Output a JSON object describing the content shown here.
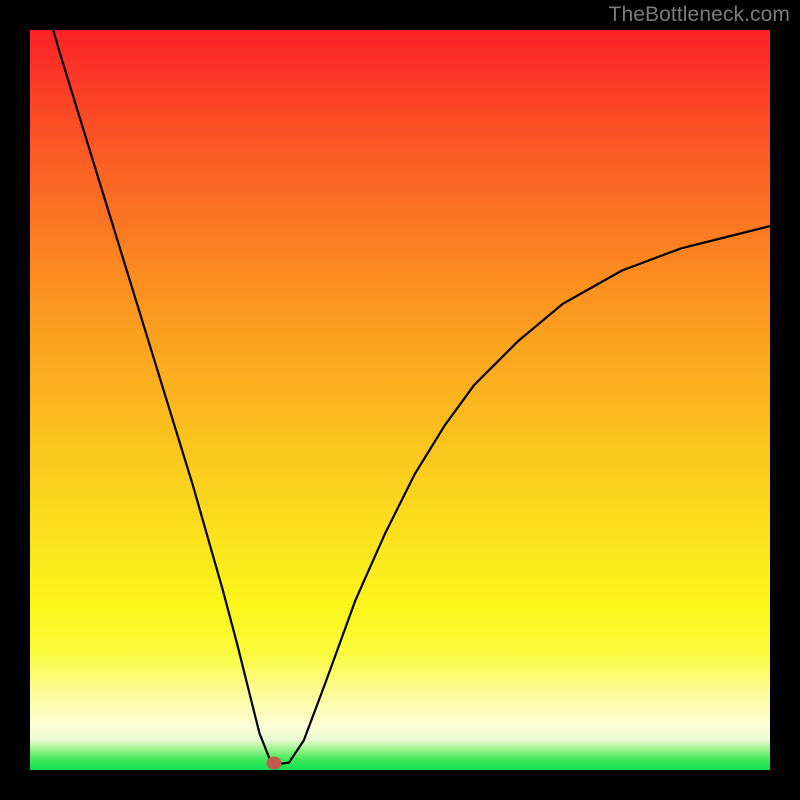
{
  "watermark": "TheBottleneck.com",
  "marker": {
    "color": "#c25a4e",
    "x_pct": 33.0,
    "y_pct": 99.0
  },
  "chart_data": {
    "type": "line",
    "title": "",
    "xlabel": "",
    "ylabel": "",
    "xlim": [
      0,
      100
    ],
    "ylim": [
      0,
      100
    ],
    "grid": false,
    "legend": false,
    "background_gradient": {
      "direction": "top-to-bottom",
      "stops": [
        {
          "pos": 0.0,
          "color": "#fb2127"
        },
        {
          "pos": 0.34,
          "color": "#fb8e20"
        },
        {
          "pos": 0.78,
          "color": "#fbf61b"
        },
        {
          "pos": 0.94,
          "color": "#fdfdd6"
        },
        {
          "pos": 1.0,
          "color": "#0ee153"
        }
      ]
    },
    "series": [
      {
        "name": "bottleneck-curve",
        "color": "#000000",
        "stroke_width": 2,
        "x": [
          0.0,
          2,
          4,
          6,
          8,
          10,
          12,
          14,
          16,
          18,
          20,
          22,
          24,
          26,
          28,
          29.5,
          31,
          32.5,
          33.5,
          35,
          37,
          40,
          44,
          48,
          52,
          56,
          60,
          66,
          72,
          80,
          88,
          96,
          100
        ],
        "y": [
          111,
          104,
          97,
          90.5,
          84,
          77.5,
          71,
          64.5,
          58,
          51.5,
          45,
          38.5,
          31.5,
          24.5,
          17,
          11,
          5,
          1.2,
          0.8,
          1.0,
          4,
          12,
          23,
          32,
          40,
          46.5,
          52,
          58,
          63,
          67.5,
          70.5,
          72.5,
          73.5
        ]
      }
    ],
    "marker_point": {
      "x": 33.0,
      "y": 1.0,
      "color": "#c25a4e"
    }
  }
}
